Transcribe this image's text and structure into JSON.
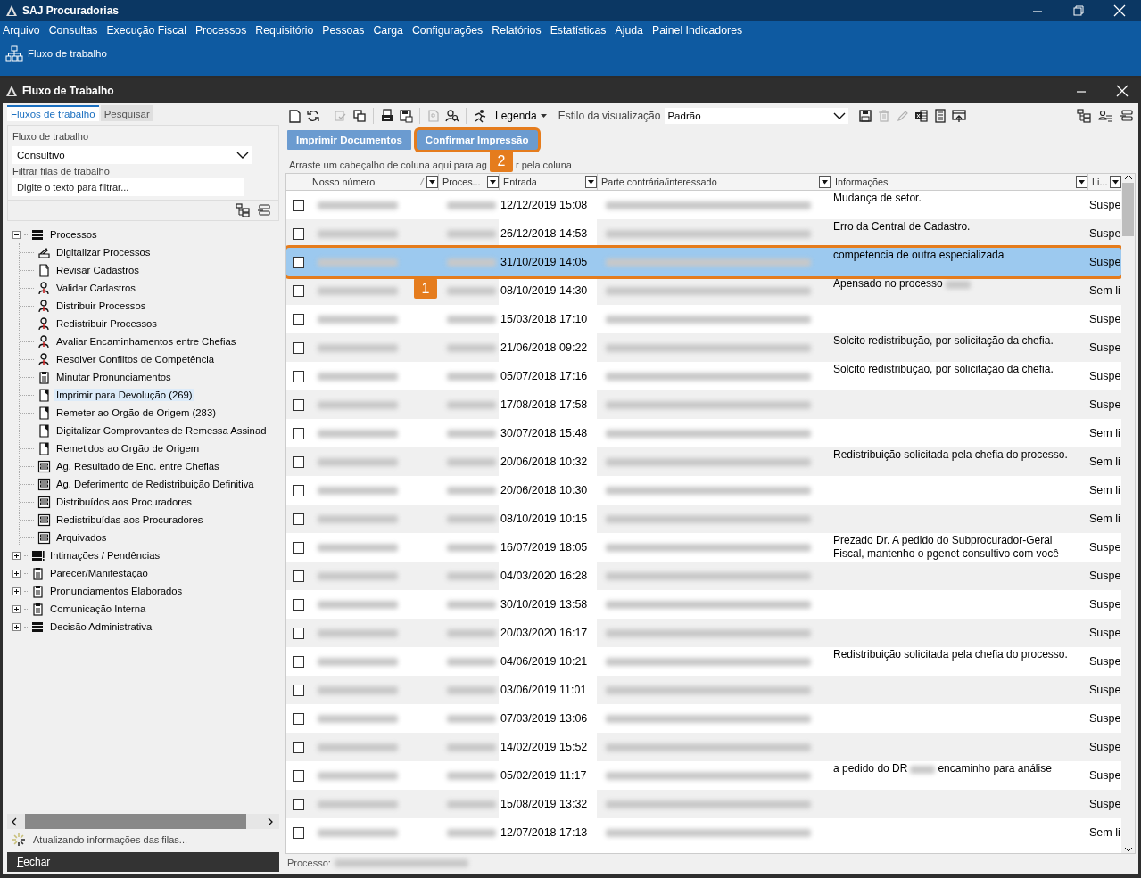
{
  "app": {
    "title": "SAJ Procuradorias"
  },
  "menu": [
    "Arquivo",
    "Consultas",
    "Execução Fiscal",
    "Processos",
    "Requisitório",
    "Pessoas",
    "Carga",
    "Configurações",
    "Relatórios",
    "Estatísticas",
    "Ajuda",
    "Painel Indicadores"
  ],
  "quick_link": "Fluxo de trabalho",
  "window": {
    "title": "Fluxo de Trabalho"
  },
  "sidebar": {
    "tabs": [
      {
        "label": "Fluxos de trabalho",
        "selected": true
      },
      {
        "label": "Pesquisar",
        "selected": false
      }
    ],
    "workflow_label": "Fluxo de trabalho",
    "workflow_value": "Consultivo",
    "filter_label": "Filtrar filas de trabalho",
    "filter_placeholder": "Digite o texto para filtrar...",
    "tree": [
      {
        "label": "Processos",
        "kind": "stack",
        "expanded": true,
        "children": [
          {
            "label": "Digitalizar Processos",
            "kind": "scan",
            "selected": false
          },
          {
            "label": "Revisar Cadastros",
            "kind": "page",
            "selected": false
          },
          {
            "label": "Validar Cadastros",
            "kind": "user",
            "selected": false
          },
          {
            "label": "Distribuir Processos",
            "kind": "user",
            "selected": false
          },
          {
            "label": "Redistribuir Processos",
            "kind": "user",
            "selected": false
          },
          {
            "label": "Avaliar Encaminhamentos entre Chefias",
            "kind": "user",
            "selected": false
          },
          {
            "label": "Resolver Conflitos de Competência",
            "kind": "user",
            "selected": false
          },
          {
            "label": "Minutar Pronunciamentos",
            "kind": "clipboard",
            "selected": false
          },
          {
            "label": "Imprimir para Devolução (269)",
            "kind": "flagpage",
            "selected": true
          },
          {
            "label": "Remeter ao Orgão de Origem (283)",
            "kind": "flagpage",
            "selected": false
          },
          {
            "label": "Digitalizar Comprovantes de Remessa Assinad",
            "kind": "flagpage",
            "selected": false
          },
          {
            "label": "Remetidos ao Orgão de Origem",
            "kind": "flagpage",
            "selected": false
          },
          {
            "label": "Ag. Resultado de Enc. entre Chefias",
            "kind": "queue",
            "selected": false
          },
          {
            "label": "Ag. Deferimento de Redistribuição Definitiva",
            "kind": "queue",
            "selected": false
          },
          {
            "label": "Distribuídos aos Procuradores",
            "kind": "queue",
            "selected": false
          },
          {
            "label": "Redistribuídas aos Procuradores",
            "kind": "queue",
            "selected": false
          },
          {
            "label": "Arquivados",
            "kind": "queue",
            "selected": false
          }
        ]
      },
      {
        "label": "Intimações / Pendências",
        "kind": "stackalert",
        "expanded": false
      },
      {
        "label": "Parecer/Manifestação",
        "kind": "clipboard",
        "expanded": false
      },
      {
        "label": "Pronunciamentos Elaborados",
        "kind": "clipboard",
        "expanded": false
      },
      {
        "label": "Comunicação Interna",
        "kind": "clipboard",
        "expanded": false
      },
      {
        "label": "Decisão Administrativa",
        "kind": "stack",
        "expanded": false
      }
    ],
    "status": "Atualizando informações das filas...",
    "close_button": "Fechar"
  },
  "toolbar": {
    "tools": [
      {
        "disabled": false
      },
      {
        "disabled": false
      },
      {
        "disabled": true
      },
      {
        "disabled": false
      },
      {
        "disabled": false
      },
      {
        "disabled": false
      },
      {
        "disabled": true
      },
      {
        "disabled": false
      },
      {
        "disabled": false
      }
    ],
    "legend_button": "Legenda",
    "view_style_label": "Estilo da visualização",
    "view_style_value": "Padrão",
    "tools_after": [
      {
        "disabled": false
      },
      {
        "disabled": true
      },
      {
        "disabled": true
      },
      {
        "disabled": false
      },
      {
        "disabled": false
      },
      {
        "disabled": false
      }
    ]
  },
  "actions": [
    {
      "label": "Imprimir Documentos"
    },
    {
      "label": "Confirmar Impressão",
      "callout": "2"
    }
  ],
  "group_hint": [
    "Arraste um cabeçalho de coluna aqui para ag",
    "r pela coluna"
  ],
  "table": {
    "columns": [
      {
        "label": "Nosso número",
        "kind": "redacted",
        "sorted": true
      },
      {
        "label": "Proces...",
        "kind": "redacted",
        "sorted": false
      },
      {
        "label": "Entrada",
        "kind": "date",
        "sorted": false
      },
      {
        "label": "Parte contrária/interessado",
        "kind": "redacted",
        "sorted": false
      },
      {
        "label": "Informações",
        "kind": "info",
        "sorted": false
      },
      {
        "label": "Li...",
        "kind": "status",
        "sorted": false
      }
    ],
    "rows": [
      {
        "checked": false,
        "selected": false,
        "entrada": "12/12/2019 15:08",
        "info": [
          {
            "kind": "text",
            "text": "Mudança de setor."
          }
        ],
        "status": "Suspe"
      },
      {
        "checked": false,
        "selected": false,
        "entrada": "26/12/2018 14:53",
        "info": [
          {
            "kind": "text",
            "text": "Erro da Central de Cadastro."
          }
        ],
        "status": "Suspe"
      },
      {
        "checked": false,
        "selected": true,
        "callout": "1",
        "entrada": "31/10/2019 14:05",
        "info": [
          {
            "kind": "text",
            "text": "competencia de outra especializada"
          }
        ],
        "status": "Suspe"
      },
      {
        "checked": false,
        "selected": false,
        "entrada": "08/10/2019 14:30",
        "info": [
          {
            "kind": "text",
            "text": "Apensado no processo"
          },
          {
            "kind": "redacted"
          }
        ],
        "status": "Sem li"
      },
      {
        "checked": false,
        "selected": false,
        "entrada": "15/03/2018 17:10",
        "info": [],
        "status": "Suspe"
      },
      {
        "checked": false,
        "selected": false,
        "entrada": "21/06/2018 09:22",
        "info": [
          {
            "kind": "text",
            "text": "Solcito redistribução, por solicitação da chefia."
          }
        ],
        "status": "Suspe"
      },
      {
        "checked": false,
        "selected": false,
        "entrada": "05/07/2018 17:16",
        "info": [
          {
            "kind": "text",
            "text": "Solcito redistribução, por solicitação da chefia."
          }
        ],
        "status": "Suspe"
      },
      {
        "checked": false,
        "selected": false,
        "entrada": "17/08/2018 17:58",
        "info": [],
        "status": "Suspe"
      },
      {
        "checked": false,
        "selected": false,
        "entrada": "30/07/2018 15:48",
        "info": [],
        "status": "Sem li"
      },
      {
        "checked": false,
        "selected": false,
        "entrada": "20/06/2018 10:32",
        "info": [
          {
            "kind": "text",
            "text": "Redistribuição solicitada pela chefia do processo."
          }
        ],
        "status": "Sem li"
      },
      {
        "checked": false,
        "selected": false,
        "entrada": "20/06/2018 10:30",
        "info": [],
        "status": "Sem li"
      },
      {
        "checked": false,
        "selected": false,
        "entrada": "08/10/2019 10:15",
        "info": [],
        "status": "Sem li"
      },
      {
        "checked": false,
        "selected": false,
        "entrada": "16/07/2019 18:05",
        "info": [
          {
            "kind": "text",
            "text": "Prezado Dr. A pedido do Subprocurador-Geral Fiscal, mantenho o pgenet consultivo com você"
          }
        ],
        "status": "Suspe"
      },
      {
        "checked": false,
        "selected": false,
        "entrada": "04/03/2020 16:28",
        "info": [],
        "status": "Suspe"
      },
      {
        "checked": false,
        "selected": false,
        "entrada": "30/10/2019 13:58",
        "info": [],
        "status": "Suspe"
      },
      {
        "checked": false,
        "selected": false,
        "entrada": "20/03/2020 16:17",
        "info": [],
        "status": "Suspe"
      },
      {
        "checked": false,
        "selected": false,
        "entrada": "04/06/2019 10:21",
        "info": [
          {
            "kind": "text",
            "text": "Redistribuição solicitada pela chefia do processo."
          }
        ],
        "status": "Suspe"
      },
      {
        "checked": false,
        "selected": false,
        "entrada": "03/06/2019 11:01",
        "info": [],
        "status": "Suspe"
      },
      {
        "checked": false,
        "selected": false,
        "entrada": "07/03/2019 13:06",
        "info": [],
        "status": "Suspe"
      },
      {
        "checked": false,
        "selected": false,
        "entrada": "14/02/2019 15:52",
        "info": [],
        "status": "Suspe"
      },
      {
        "checked": false,
        "selected": false,
        "entrada": "05/02/2019 11:17",
        "info": [
          {
            "kind": "text",
            "text": "a pedido do DR"
          },
          {
            "kind": "redacted"
          },
          {
            "kind": "text",
            "text": "encaminho para análise"
          }
        ],
        "status": "Suspe"
      },
      {
        "checked": false,
        "selected": false,
        "entrada": "15/08/2019 13:32",
        "info": [],
        "status": "Suspe"
      },
      {
        "checked": false,
        "selected": false,
        "entrada": "12/07/2018 17:13",
        "info": [],
        "status": "Sem li"
      }
    ]
  },
  "grid_status": "Processo:"
}
